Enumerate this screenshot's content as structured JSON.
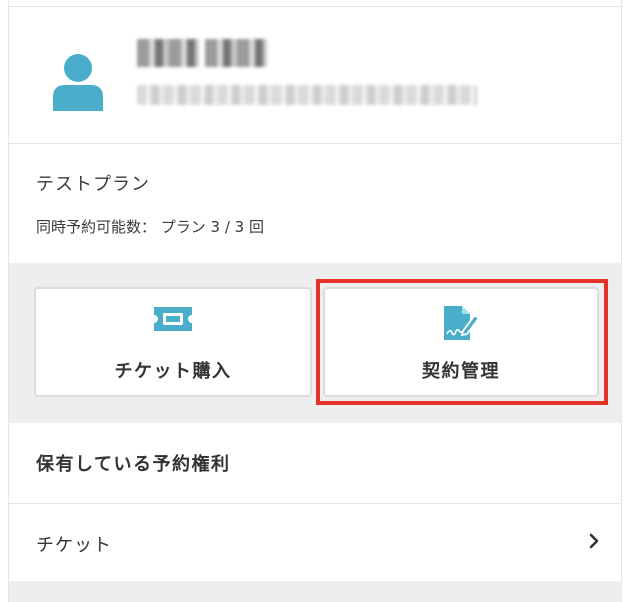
{
  "plan": {
    "name": "テストプラン",
    "limit_text": "同時予約可能数： プラン 3 / 3 回"
  },
  "actions": {
    "ticket_label": "チケット購入",
    "contract_label": "契約管理"
  },
  "rights": {
    "title": "保有している予約権利",
    "ticket_label": "チケット"
  },
  "colors": {
    "accent": "#4aaecb",
    "highlight": "#e6332a",
    "band": "#eeeeee"
  },
  "icons": {
    "avatar": "user-icon",
    "ticket": "ticket-icon",
    "contract": "contract-icon",
    "chevron": "chevron-right-icon"
  }
}
